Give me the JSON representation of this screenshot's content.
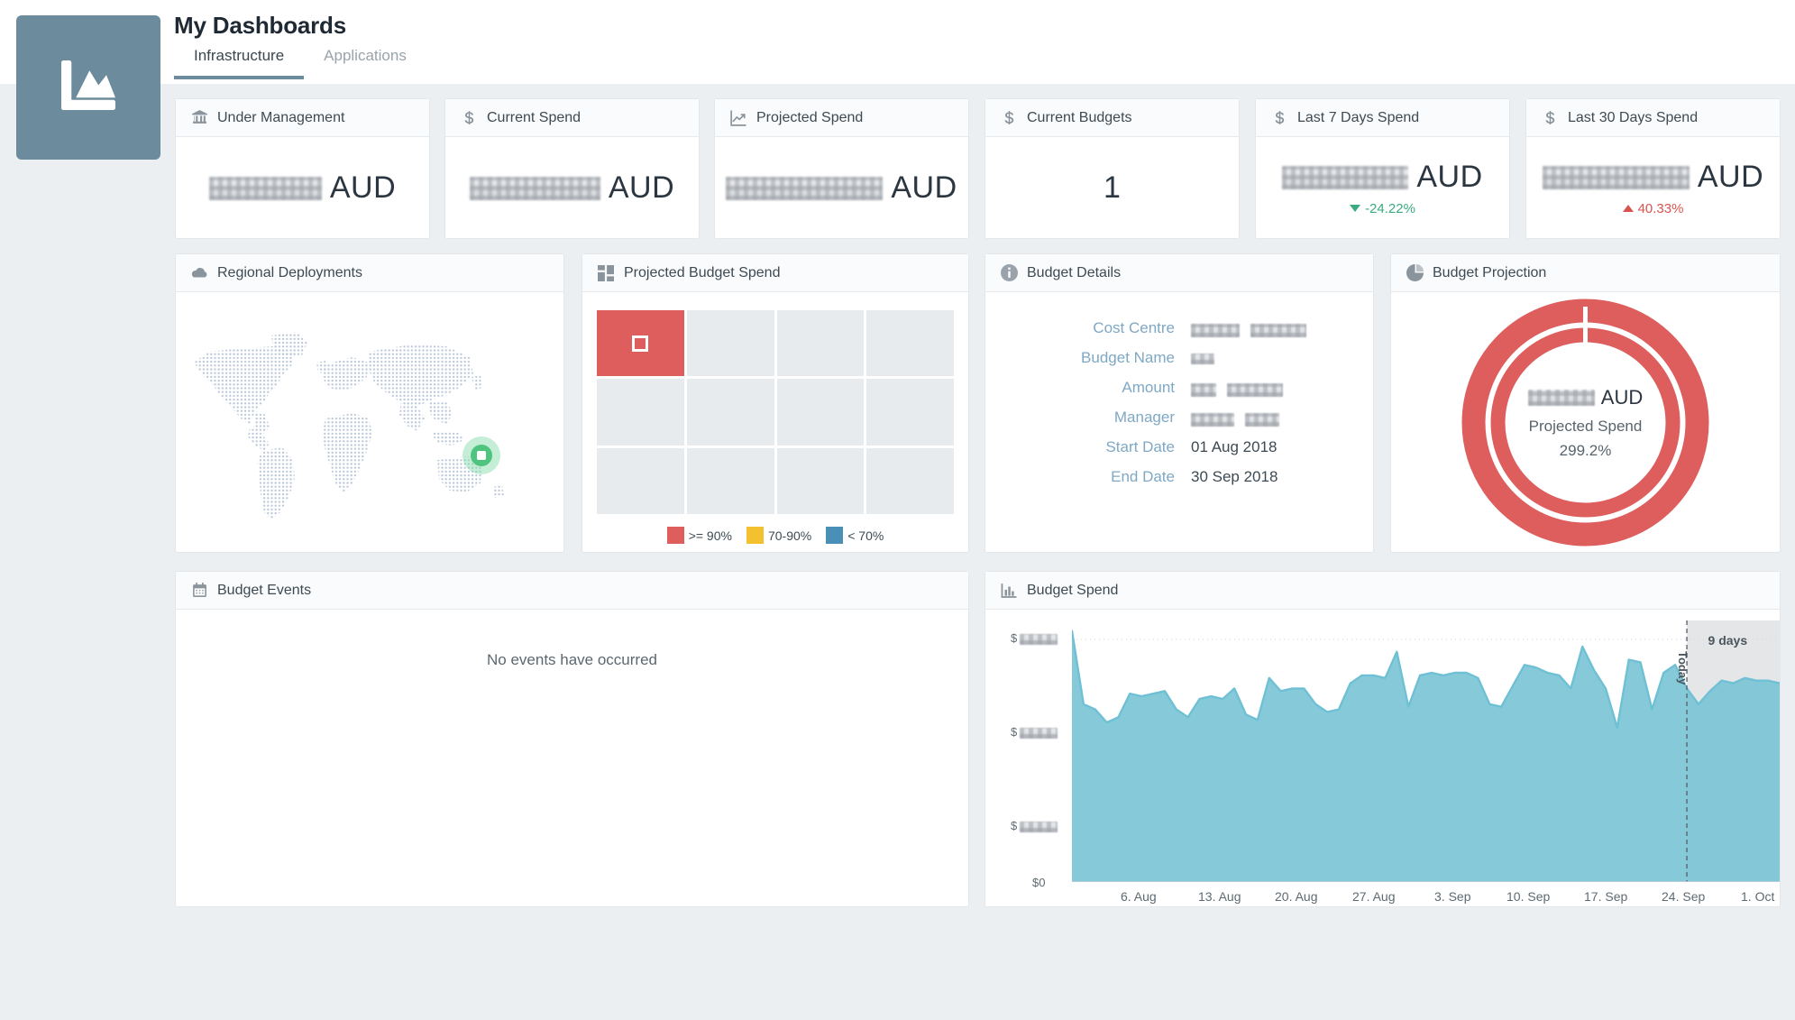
{
  "header": {
    "title": "My Dashboards",
    "logo_icon": "area-chart-icon",
    "logo_color": "#6c8c9e",
    "tabs": [
      {
        "label": "Infrastructure",
        "active": true
      },
      {
        "label": "Applications",
        "active": false
      }
    ]
  },
  "kpis": [
    {
      "title": "Under Management",
      "icon": "bank-icon",
      "value": "",
      "redacted": true,
      "currency": "AUD",
      "delta": null
    },
    {
      "title": "Current Spend",
      "icon": "dollar-icon",
      "value": "",
      "redacted": true,
      "currency": "AUD",
      "delta": null
    },
    {
      "title": "Projected Spend",
      "icon": "line-chart-icon",
      "value": "",
      "redacted": true,
      "currency": "AUD",
      "delta": null
    },
    {
      "title": "Current Budgets",
      "icon": "dollar-icon",
      "value": "1",
      "redacted": false,
      "currency": "",
      "delta": null
    },
    {
      "title": "Last 7 Days Spend",
      "icon": "dollar-icon",
      "value": "",
      "redacted": true,
      "currency": "AUD",
      "delta": {
        "text": "-24.22%",
        "direction": "down",
        "color": "#3aab7f"
      }
    },
    {
      "title": "Last 30 Days Spend",
      "icon": "dollar-icon",
      "value": "",
      "redacted": true,
      "currency": "AUD",
      "delta": {
        "text": "40.33%",
        "direction": "up",
        "color": "#d9534f"
      }
    }
  ],
  "regional": {
    "title": "Regional Deployments",
    "icon": "cloud-icon",
    "marker_label": "Sydney",
    "marker_color": "#4fc47f"
  },
  "projected_budget_spend": {
    "title": "Projected Budget Spend",
    "icon": "grid-icon",
    "cells": [
      {
        "state": "hot",
        "selected": true
      },
      {
        "state": "empty"
      },
      {
        "state": "empty"
      },
      {
        "state": "empty"
      },
      {
        "state": "empty"
      },
      {
        "state": "empty"
      },
      {
        "state": "empty"
      },
      {
        "state": "empty"
      },
      {
        "state": "empty"
      },
      {
        "state": "empty"
      },
      {
        "state": "empty"
      },
      {
        "state": "empty"
      }
    ],
    "legend": [
      {
        "label": ">= 90%",
        "color": "#dd5e5c"
      },
      {
        "label": "70-90%",
        "color": "#f3c02f"
      },
      {
        "label": "< 70%",
        "color": "#4a8fb5"
      }
    ]
  },
  "budget_details": {
    "title": "Budget Details",
    "icon": "info-icon",
    "rows": [
      {
        "label": "Cost Centre",
        "value": "",
        "redacted": true
      },
      {
        "label": "Budget Name",
        "value": "",
        "redacted": true
      },
      {
        "label": "Amount",
        "value": "",
        "redacted": true
      },
      {
        "label": "Manager",
        "value": "",
        "redacted": true
      },
      {
        "label": "Start Date",
        "value": "01 Aug 2018",
        "redacted": false
      },
      {
        "label": "End Date",
        "value": "30 Sep 2018",
        "redacted": false
      }
    ]
  },
  "budget_projection": {
    "title": "Budget Projection",
    "icon": "pie-chart-icon",
    "amount": "",
    "amount_redacted": true,
    "currency": "AUD",
    "center_label": "Projected Spend",
    "percent": "299.2%",
    "ring_color": "#dd5e5c",
    "rings": 2
  },
  "budget_events": {
    "title": "Budget Events",
    "icon": "calendar-icon",
    "empty_message": "No events have occurred"
  },
  "chart_data": {
    "type": "area",
    "title": "Budget Spend",
    "icon": "bar-chart-icon",
    "xlabel": "",
    "ylabel": "",
    "grid": true,
    "legend_position": "none",
    "series_color": "#6fc0d4",
    "fill_color": "#79c4d6",
    "ytick_labels": [
      "$0",
      "$",
      "$",
      "$"
    ],
    "ytick_redacted": [
      false,
      true,
      true,
      true
    ],
    "ylim": [
      0,
      100
    ],
    "categories": [
      "6. Aug",
      "13. Aug",
      "20. Aug",
      "27. Aug",
      "3. Sep",
      "10. Sep",
      "17. Sep",
      "24. Sep",
      "1. Oct"
    ],
    "x": [
      "1. Aug",
      "2. Aug",
      "3. Aug",
      "4. Aug",
      "5. Aug",
      "6. Aug",
      "7. Aug",
      "8. Aug",
      "9. Aug",
      "10. Aug",
      "11. Aug",
      "12. Aug",
      "13. Aug",
      "14. Aug",
      "15. Aug",
      "16. Aug",
      "17. Aug",
      "18. Aug",
      "19. Aug",
      "20. Aug",
      "21. Aug",
      "22. Aug",
      "23. Aug",
      "24. Aug",
      "25. Aug",
      "26. Aug",
      "27. Aug",
      "28. Aug",
      "29. Aug",
      "30. Aug",
      "31. Aug",
      "1. Sep",
      "2. Sep",
      "3. Sep",
      "4. Sep",
      "5. Sep",
      "6. Sep",
      "7. Sep",
      "8. Sep",
      "9. Sep",
      "10. Sep",
      "11. Sep",
      "12. Sep",
      "13. Sep",
      "14. Sep",
      "15. Sep",
      "16. Sep",
      "17. Sep",
      "18. Sep",
      "19. Sep",
      "20. Sep",
      "21. Sep",
      "22. Sep",
      "23. Sep",
      "24. Sep",
      "25. Sep",
      "26. Sep",
      "27. Sep",
      "28. Sep",
      "29. Sep",
      "30. Sep",
      "1. Oct"
    ],
    "values": [
      96,
      68,
      66,
      61,
      63,
      72,
      71,
      72,
      73,
      66,
      63,
      70,
      71,
      70,
      74,
      64,
      62,
      78,
      73,
      74,
      74,
      68,
      65,
      66,
      76,
      79,
      79,
      78,
      88,
      67,
      79,
      80,
      79,
      80,
      80,
      78,
      68,
      67,
      75,
      83,
      82,
      80,
      79,
      74,
      90,
      81,
      74,
      59,
      85,
      84,
      66,
      80,
      83,
      74,
      68,
      73,
      77,
      76,
      78,
      77,
      77,
      76
    ],
    "plot_band": {
      "label": "9 days",
      "start": "23. Sep",
      "end": "1. Oct",
      "color": "#e4e6e8"
    },
    "plot_line": {
      "label": "Today",
      "at": "23. Sep",
      "style": "dashed"
    }
  }
}
